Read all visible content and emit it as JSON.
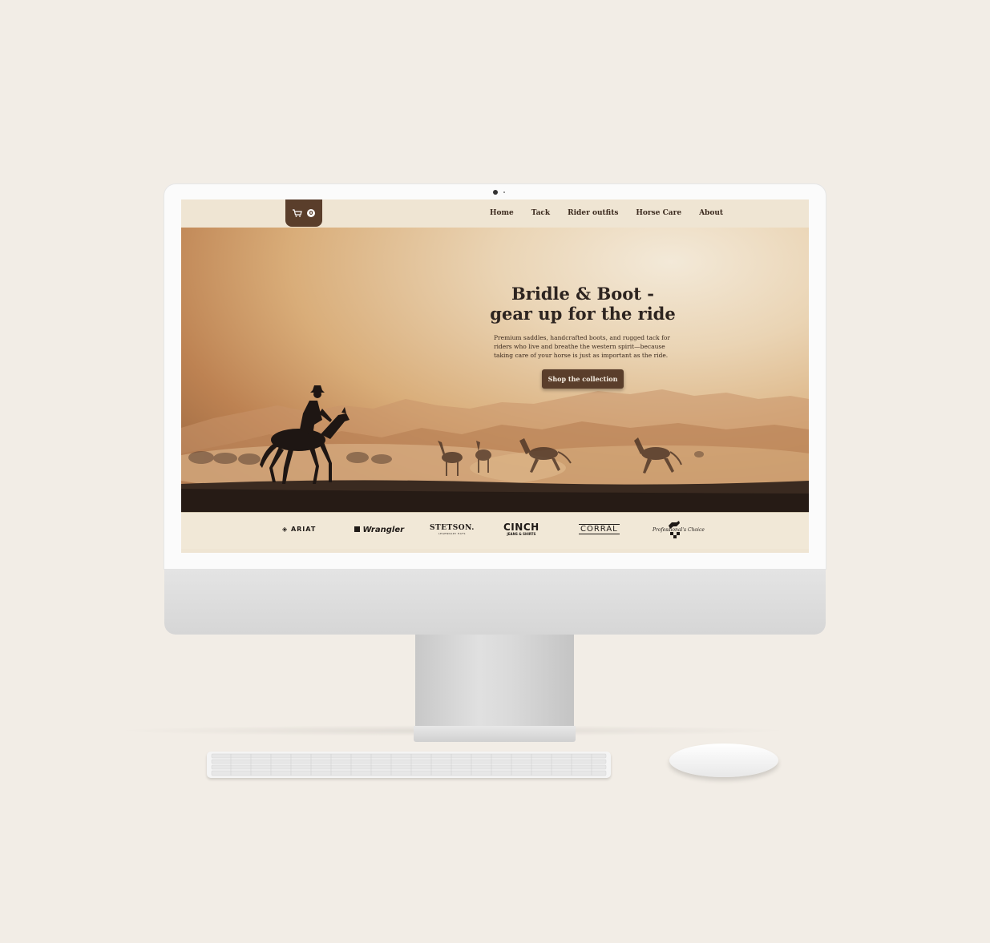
{
  "cart": {
    "count": "0"
  },
  "nav": {
    "items": [
      "Home",
      "Tack",
      "Rider outfits",
      "Horse Care",
      "About"
    ]
  },
  "hero": {
    "title_line1": "Bridle & Boot -",
    "title_line2": "gear up for the ride",
    "description": "Premium saddles, handcrafted boots, and rugged tack for riders who live and breathe the western spirit—because taking care of your horse is just as important as the ride.",
    "cta": "Shop the collection"
  },
  "brands": {
    "ariat": "ARIAT",
    "wrangler": "Wrangler",
    "stetson": "STETSON.",
    "stetson_sub": "LEGENDARY HATS",
    "cinch": "CINCH",
    "cinch_sub": "JEANS & SHIRTS",
    "corral": "CORRAL",
    "professionals_choice": "Professional's Choice"
  },
  "colors": {
    "accent": "#5a3e2b",
    "nav_bg": "#efe5d3",
    "background": "#f2ede6"
  }
}
